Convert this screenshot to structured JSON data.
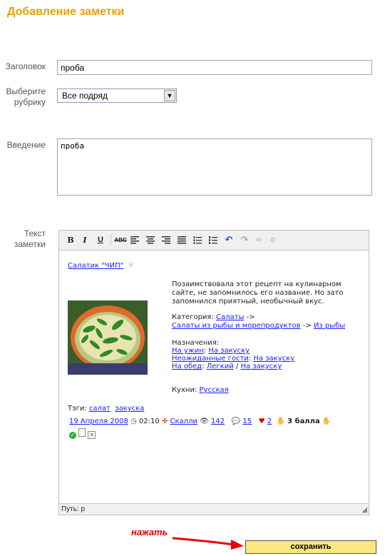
{
  "page": {
    "title": "Добавление заметки"
  },
  "form": {
    "heading_label": "Заголовок",
    "heading_value": "проба",
    "rubric_label_1": "Выберите",
    "rubric_label_2": "рубрику",
    "rubric_value": "Все подряд",
    "intro_label": "Введение",
    "intro_value": "проба",
    "text_label_1": "Текст",
    "text_label_2": "заметки"
  },
  "toolbar": {
    "buttons": [
      "bold",
      "italic",
      "underline",
      "strikethrough",
      "align-left",
      "align-center",
      "align-right",
      "align-justify",
      "bullet-list",
      "numbered-list",
      "undo",
      "redo",
      "link",
      "unlink"
    ]
  },
  "note": {
    "recipe_link": "Салатик \"ЧИП\"",
    "desc_1": "Позаимствовала этот рецепт на кулинарном",
    "desc_2": "сайте, не запомнилось его название. Но зато",
    "desc_3": "запомнился приятный, необычный вкус.",
    "category_label": "Категория:",
    "category_1": "Салаты",
    "category_arrow": "->",
    "category_2": "Салаты из рыбы и морепродуктов",
    "category_3": "Из рыбы",
    "purpose_label": "Назначения:",
    "p1a": "На ужин",
    "p1b": "На закуску",
    "p2a": "Неожиданные гости",
    "p2b": "На закуску",
    "p3a": "На обед",
    "p3b": "Легкий",
    "p3c": "На закуску",
    "cuisine_label": "Кухни:",
    "cuisine": "Русская",
    "tags_label": "Тэги:",
    "tag_1": "салат",
    "tag_2": "закуска",
    "date": "19 Апреля 2008",
    "time": "02:10",
    "author": "Скалли",
    "views": "142",
    "comments": "15",
    "likes": "2",
    "rating": "3 балла"
  },
  "statusbar": {
    "path": "Путь: p"
  },
  "actions": {
    "arrow_label": "нажать",
    "save": "сохранить"
  },
  "colors": {
    "title": "#e8a100",
    "save_bg": "#fbe77e",
    "link": "#1a1aff",
    "arrow": "#e00000"
  }
}
